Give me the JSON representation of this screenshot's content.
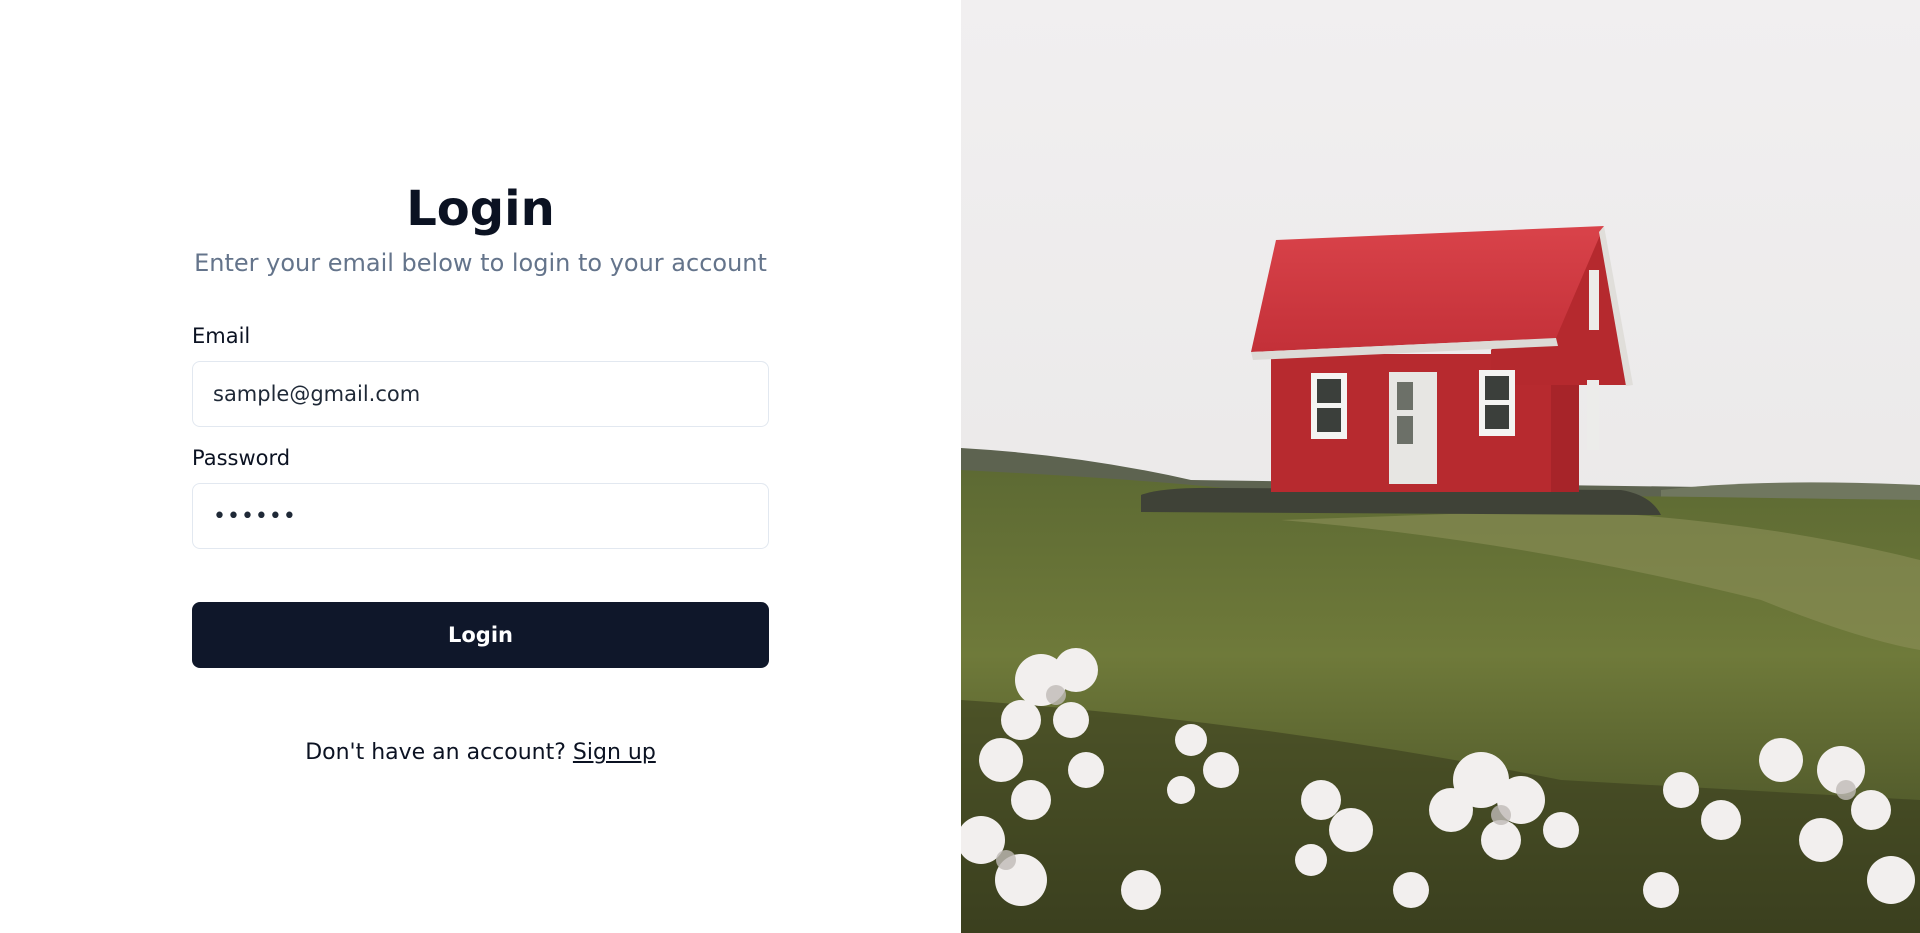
{
  "form": {
    "title": "Login",
    "subtitle": "Enter your email below to login to your account",
    "email_label": "Email",
    "email_value": "sample@gmail.com",
    "password_label": "Password",
    "password_value": "••••••",
    "login_button": "Login",
    "signup_prompt": "Don't have an account? ",
    "signup_link": "Sign up"
  },
  "colors": {
    "primary": "#0f172a",
    "muted_text": "#64748b",
    "border": "#e2e8f0"
  },
  "hero_image": {
    "subject": "red-house-on-grassy-hill-with-white-flowers"
  }
}
